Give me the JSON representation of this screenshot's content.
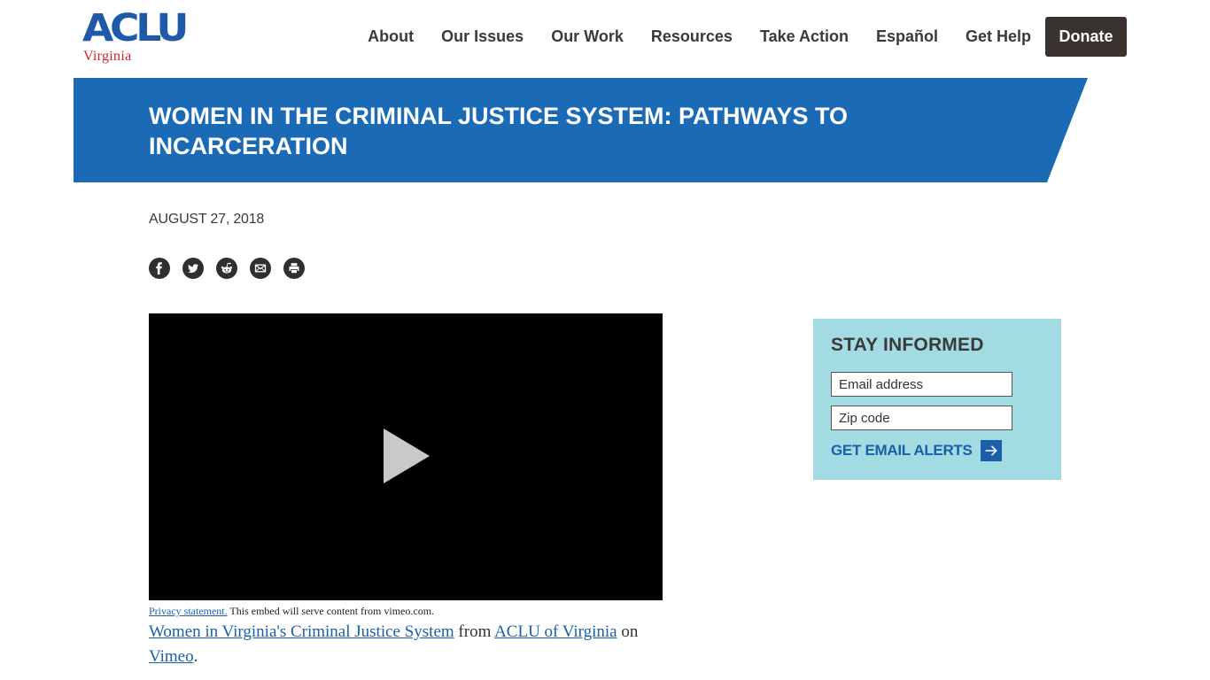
{
  "logo": {
    "mark": "ACLU",
    "affiliate": "Virginia"
  },
  "nav": {
    "items": [
      "About",
      "Our Issues",
      "Our Work",
      "Resources",
      "Take Action",
      "Español",
      "Get Help"
    ],
    "donate_label": "Donate"
  },
  "article": {
    "title": "Women in the Criminal Justice System: Pathways to Incarceration",
    "date": "AUGUST 27, 2018"
  },
  "share": {
    "icons": [
      "facebook-icon",
      "twitter-icon",
      "reddit-icon",
      "email-icon",
      "print-icon"
    ]
  },
  "video": {
    "privacy_link": "Privacy statement.",
    "privacy_text": " This embed will serve content from vimeo.com.",
    "caption": {
      "title_link": "Women in Virginia's Criminal Justice System",
      "from_text": " from ",
      "author_link": "ACLU of Virginia",
      "on_text": " on ",
      "platform_link": "Vimeo",
      "end_text": "."
    }
  },
  "signup": {
    "heading": "STAY INFORMED",
    "email_placeholder": "Email address",
    "zip_placeholder": "Zip code",
    "submit_label": "GET EMAIL ALERTS"
  },
  "colors": {
    "brand_blue": "#1b6ab6",
    "brand_red": "#d2252c",
    "donate_bg": "#3a322e",
    "signup_bg": "#a3dbe3",
    "link_blue": "#1b5fa8"
  }
}
